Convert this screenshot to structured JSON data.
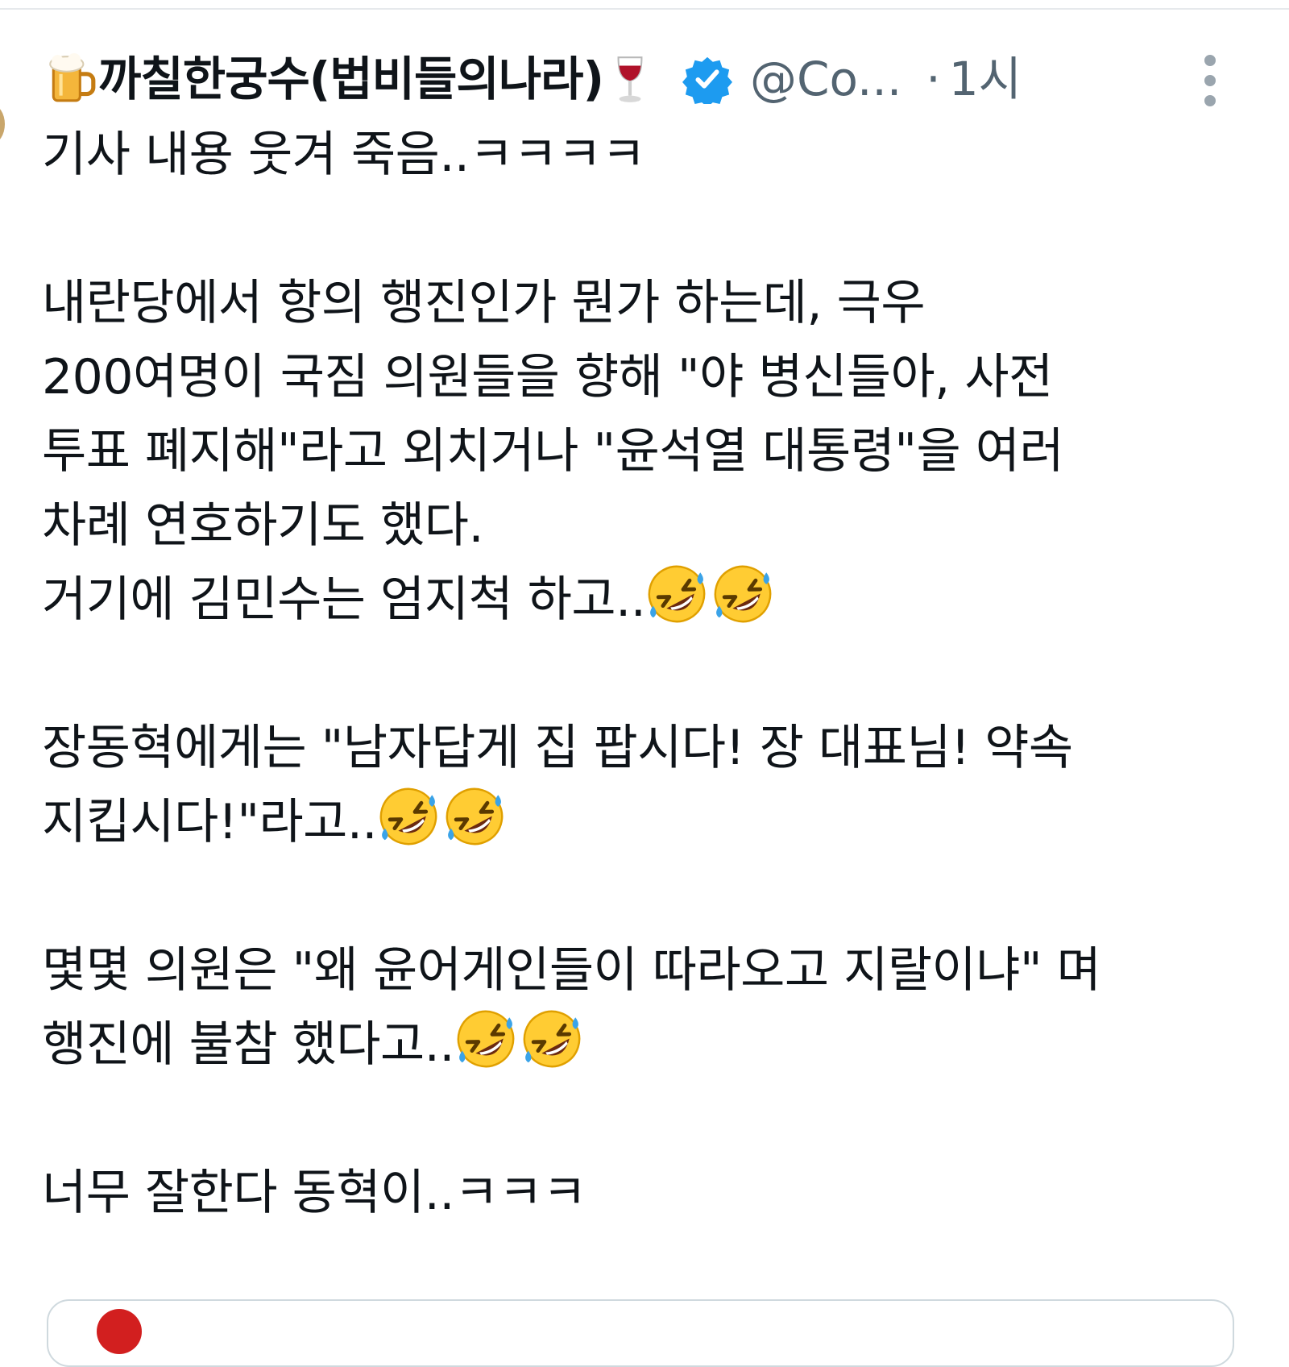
{
  "tweet": {
    "display_name_prefix_emoji": "beer-mug-icon",
    "display_name": "까칠한궁수(법비들의나라)",
    "display_name_suffix_emoji": "wine-glass-icon",
    "verified_color": "#1d9bf0",
    "handle": "@Co...",
    "separator": "·",
    "time": "1시",
    "more_icon": "more-vertical-icon",
    "lines": [
      "기사 내용 웃겨 죽음..ㅋㅋㅋㅋ",
      "",
      "내란당에서 항의 행진인가 뭔가 하는데,  극우",
      "200여명이 국짐 의원들을 향해 \"야 병신들아, 사전",
      "투표 폐지해\"라고 외치거나 \"윤석열 대통령\"을 여러",
      "차례 연호하기도 했다.",
      "거기에 김민수는 엄지척 하고..",
      "",
      "장동혁에게는 \"남자답게 집 팝시다! 장 대표님! 약속",
      "지킵시다!\"라고..",
      "",
      "몇몇 의원은 \"왜 윤어게인들이 따라오고 지랄이냐\" 며",
      "행진에 불참 했다고..",
      "",
      "너무 잘한다 동혁이..ㅋㅋㅋ"
    ],
    "line_emojis": {
      "6": [
        "rolling-on-floor-laughing-icon",
        "rolling-on-floor-laughing-icon"
      ],
      "9": [
        "rolling-on-floor-laughing-icon",
        "rolling-on-floor-laughing-icon"
      ],
      "12": [
        "rolling-on-floor-laughing-icon",
        "rolling-on-floor-laughing-icon"
      ]
    }
  }
}
